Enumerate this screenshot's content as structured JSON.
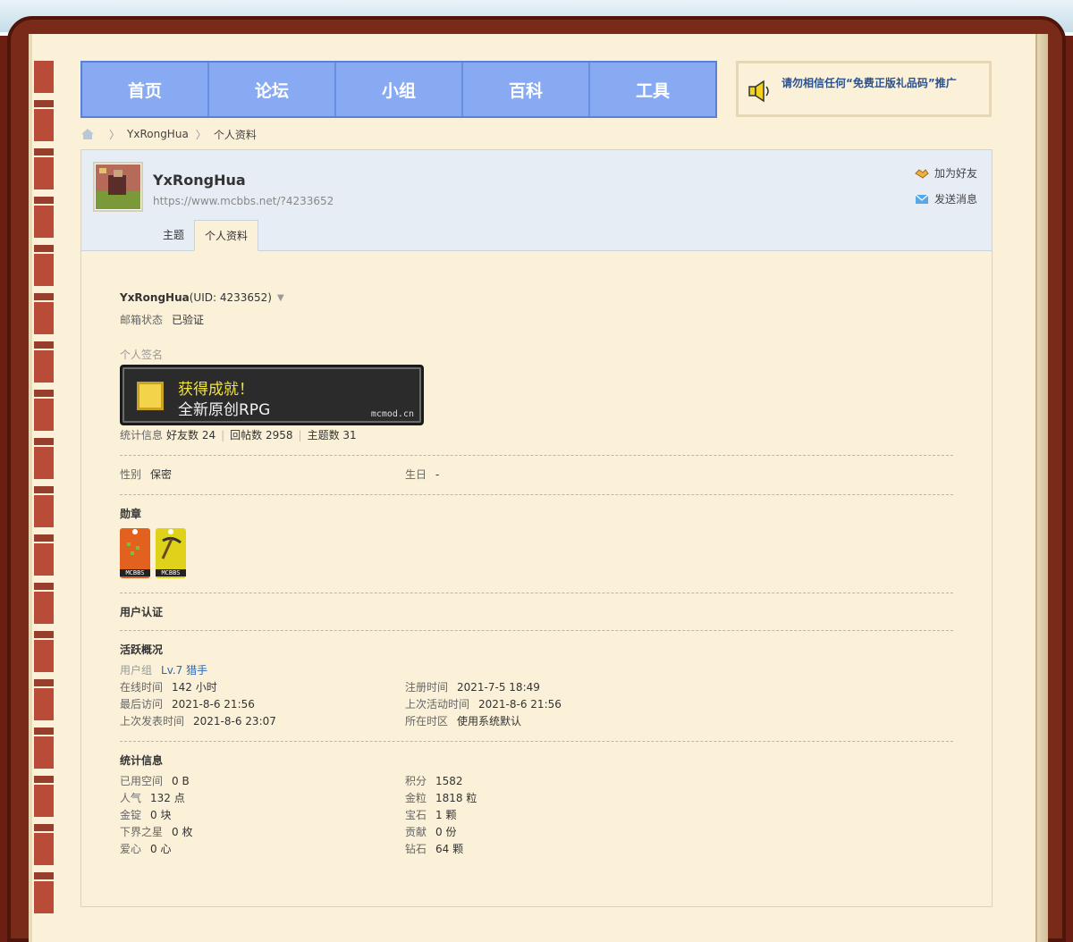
{
  "nav": [
    "首页",
    "论坛",
    "小组",
    "百科",
    "工具"
  ],
  "notice": "请勿相信任何“免费正版礼品码”推广",
  "breadcrumb": [
    "YxRongHua",
    "个人资料"
  ],
  "profile": {
    "username": "YxRongHua",
    "url": "https://www.mcbbs.net/?4233652",
    "actions": [
      "加为好友",
      "发送消息"
    ],
    "tabs": [
      "主题",
      "个人资料"
    ],
    "uid_line": "(UID: 4233652)",
    "email_label": "邮箱状态",
    "email_value": "已验证",
    "signature_label": "个人签名",
    "signature": {
      "line1": "获得成就！",
      "line2": "全新原创RPG",
      "site": "mcmod.cn"
    },
    "stats_label": "统计信息",
    "friends": "好友数 24",
    "replies": "回帖数 2958",
    "threads": "主题数 31",
    "gender_label": "性别",
    "gender": "保密",
    "birthday_label": "生日",
    "birthday": "-",
    "medals_title": "勋章",
    "medals": [
      {
        "label": "MCBBS",
        "color": "#e2611f"
      },
      {
        "label": "MCBBS",
        "color": "#e0d21a"
      }
    ],
    "verify_title": "用户认证",
    "activity_title": "活跃概况",
    "usergroup_label": "用户组",
    "usergroup": "Lv.7 猎手",
    "activity": [
      [
        "在线时间",
        "142 小时",
        "注册时间",
        "2021-7-5 18:49"
      ],
      [
        "最后访问",
        "2021-8-6 21:56",
        "上次活动时间",
        "2021-8-6 21:56"
      ],
      [
        "上次发表时间",
        "2021-8-6 23:07",
        "所在时区",
        "使用系统默认"
      ]
    ],
    "stats_title": "统计信息",
    "stats": [
      [
        "已用空间",
        "0 B",
        "积分",
        "1582"
      ],
      [
        "人气",
        "132 点",
        "金粒",
        "1818 粒"
      ],
      [
        "金锭",
        "0 块",
        "宝石",
        "1 颗"
      ],
      [
        "下界之星",
        "0 枚",
        "贡献",
        "0 份"
      ],
      [
        "爱心",
        "0 心",
        "钻石",
        "64 颗"
      ]
    ]
  }
}
